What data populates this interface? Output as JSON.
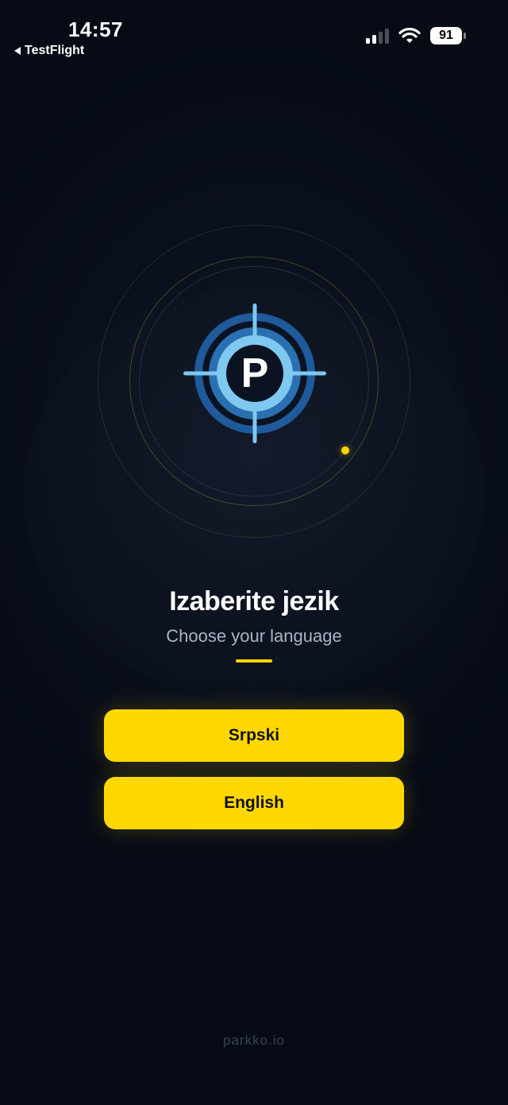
{
  "status_bar": {
    "time": "14:57",
    "back_app": "TestFlight",
    "battery": "91",
    "icons": [
      "cellular-signal-icon",
      "wifi-icon",
      "battery-icon"
    ]
  },
  "logo": {
    "letter": "P",
    "icon": "parking-target-logo"
  },
  "language_picker": {
    "title": "Izaberite jezik",
    "subtitle": "Choose your language",
    "options": [
      "Srpski",
      "English"
    ]
  },
  "footer": {
    "text": "parkko.io"
  },
  "colors": {
    "background": "#070d18",
    "accent": "#ffd800",
    "logo_dark_blue": "#1f5a9a",
    "logo_light_blue": "#7fc8f0"
  }
}
